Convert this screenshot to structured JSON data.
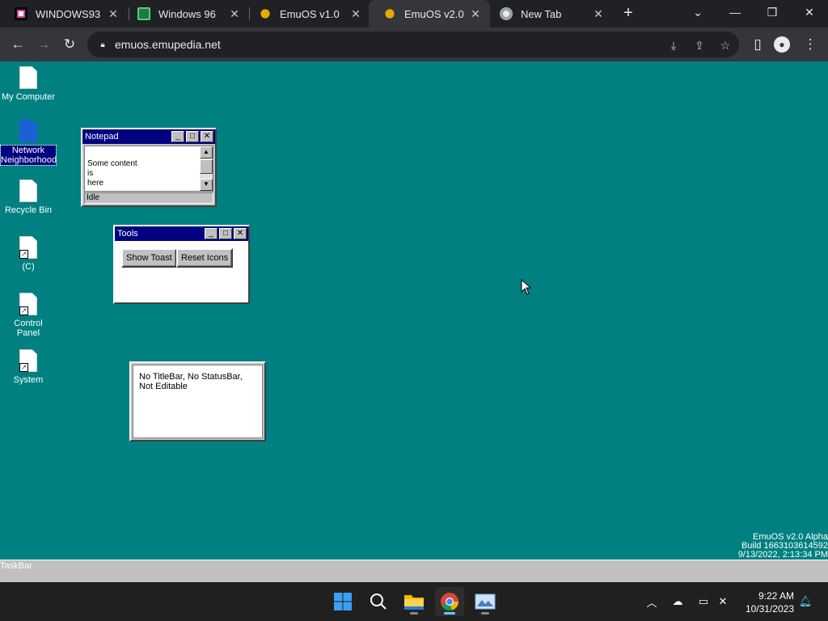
{
  "browser": {
    "tabs": [
      {
        "title": "WINDOWS93",
        "active": false,
        "icon": "windows93-favicon"
      },
      {
        "title": "Windows 96",
        "active": false,
        "icon": "windows96-favicon"
      },
      {
        "title": "EmuOS v1.0",
        "active": false,
        "icon": "emuos-favicon"
      },
      {
        "title": "EmuOS v2.0",
        "active": true,
        "icon": "emuos-favicon"
      },
      {
        "title": "New Tab",
        "active": false,
        "icon": "chrome-favicon"
      }
    ],
    "address": "emuos.emupedia.net"
  },
  "desktop": {
    "background_color": "#008080",
    "icons": [
      {
        "label": "My Computer",
        "selected": false
      },
      {
        "label": "Network Neighborhood",
        "selected": true
      },
      {
        "label": "Recycle Bin",
        "selected": false
      },
      {
        "label": "(C)",
        "selected": false
      },
      {
        "label": "Control Panel",
        "selected": false
      },
      {
        "label": "System",
        "selected": false
      }
    ],
    "notepad": {
      "title": "Notepad",
      "lines": [
        "Some content",
        "is",
        "here"
      ],
      "status": "Idle"
    },
    "tools": {
      "title": "Tools",
      "buttons": [
        "Show Toast",
        "Reset Icons"
      ]
    },
    "plain_window": {
      "text": "No TitleBar, No StatusBar, Not Editable"
    },
    "version": [
      "EmuOS v2.0 Alpha",
      "Build 1663103614592",
      "9/13/2022, 2:13:34 PM"
    ],
    "taskbar_label": "TaskBar"
  },
  "os_taskbar": {
    "time": "9:22 AM",
    "date": "10/31/2023",
    "apps": [
      "start-button",
      "search-button",
      "file-explorer",
      "chrome",
      "photos"
    ]
  },
  "colors": {
    "titlebar": "#000080",
    "chrome_dark": "#202124",
    "chrome_toolbar": "#35363a",
    "taskbar_indicator": "#60cdff"
  }
}
